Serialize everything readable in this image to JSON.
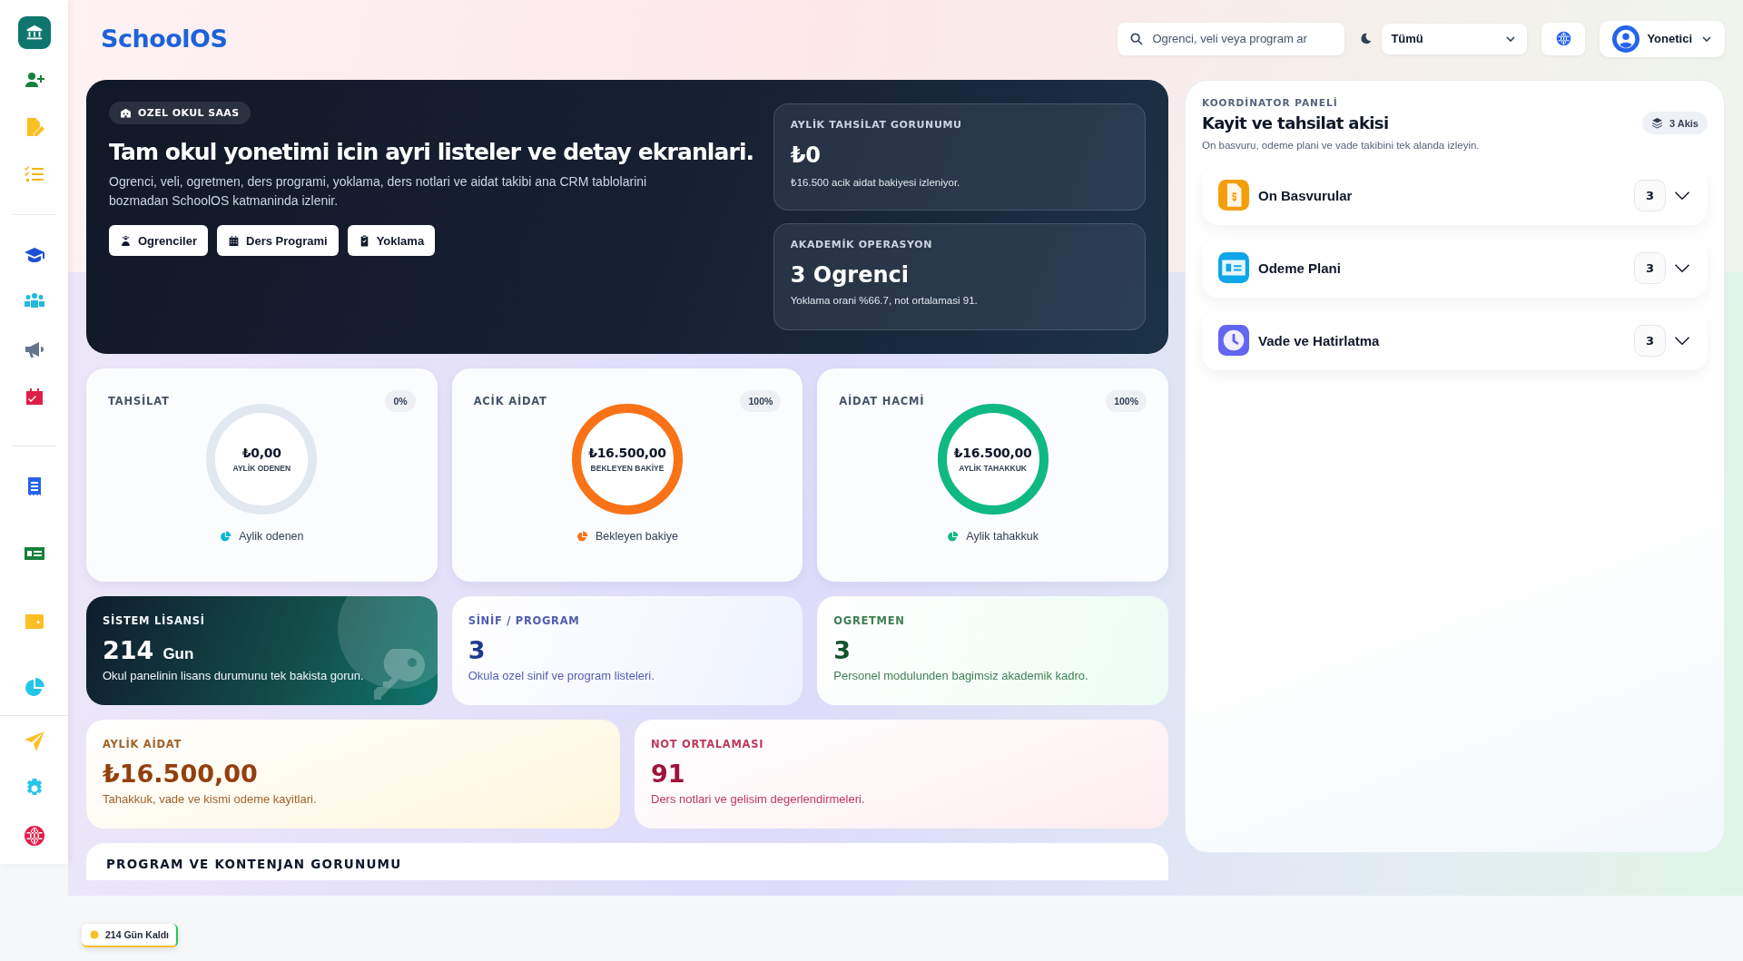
{
  "sidebar": {
    "groups": [
      {
        "items": [
          {
            "kind": "bank",
            "selected": true
          },
          {
            "kind": "user-plus",
            "selected": false
          },
          {
            "kind": "file-pen",
            "selected": false
          },
          {
            "kind": "list-check",
            "selected": false
          }
        ]
      },
      {
        "items": [
          {
            "kind": "graduation",
            "selected": false
          },
          {
            "kind": "people",
            "selected": false
          },
          {
            "kind": "megaphone",
            "selected": false
          },
          {
            "kind": "calendar",
            "selected": false
          }
        ]
      },
      {
        "items": [
          {
            "kind": "receipt",
            "selected": false
          },
          {
            "kind": "money",
            "selected": false
          },
          {
            "kind": "wallet",
            "selected": false
          },
          {
            "kind": "pie",
            "selected": false
          }
        ]
      },
      {
        "items": [
          {
            "kind": "plane",
            "selected": false
          },
          {
            "kind": "gear",
            "selected": false
          },
          {
            "kind": "globe",
            "selected": false
          }
        ]
      }
    ]
  },
  "header": {
    "logo": "SchoolOS",
    "search": {
      "placeholder": "Ogrenci, veli veya program ar"
    },
    "filter": "Tümü",
    "user": "Yonetici"
  },
  "hero": {
    "badge": "OZEL OKUL SAAS",
    "title": "Tam okul yonetimi icin ayri listeler ve detay ekranlari.",
    "description": "Ogrenci, veli, ogretmen, ders programi, yoklama, ders notlari ve aidat takibi ana CRM tablolarini bozmadan SchoolOS katmaninda izlenir.",
    "buttons": [
      {
        "label": "Ogrenciler",
        "kind": "student"
      },
      {
        "label": "Ders Programi",
        "kind": "calendar"
      },
      {
        "label": "Yoklama",
        "kind": "clipboard"
      }
    ],
    "metrics": [
      {
        "label": "AYLİK TAHSİLAT GORUNUMU",
        "value": "₺0",
        "note": "₺16.500 acik aidat bakiyesi izleniyor."
      },
      {
        "label": "AKADEMİK OPERASYON",
        "value": "3 Ogrenci",
        "note": "Yoklama orani %66.7, not ortalamasi 91."
      }
    ]
  },
  "rings": [
    {
      "title": "TAHSİLAT",
      "badge": "0%",
      "value": "₺0,00",
      "caption": "AYLİK ODENEN",
      "legend": "Aylik odenen",
      "color": "#06b6d4"
    },
    {
      "title": "ACİK AİDAT",
      "badge": "100%",
      "value": "₺16.500,00",
      "caption": "BEKLEYEN BAKİYE",
      "legend": "Bekleyen bakiye",
      "color": "#f97316"
    },
    {
      "title": "AİDAT HACMİ",
      "badge": "100%",
      "value": "₺16.500,00",
      "caption": "AYLİK TAHAKKUK",
      "legend": "Aylik tahakkuk",
      "color": "#10b981"
    }
  ],
  "info_cards": [
    {
      "kind": "license",
      "title": "SİSTEM LİSANSİ",
      "value": "214",
      "unit": "Gun",
      "note": "Okul panelinin lisans durumunu tek bakista gorun."
    },
    {
      "kind": "blue",
      "title": "SİNİF / PROGRAM",
      "value": "3",
      "note": "Okula ozel sinif ve program listeleri."
    },
    {
      "kind": "green",
      "title": "OGRETMEN",
      "value": "3",
      "note": "Personel modulunden bagimsiz akademik kadro."
    }
  ],
  "highlight_cards": [
    {
      "kind": "amber",
      "title": "AYLİK AİDAT",
      "value": "₺16.500,00",
      "note": "Tahakkuk, vade ve kismi odeme kayitlari."
    },
    {
      "kind": "rose",
      "title": "NOT ORTALAMASI",
      "value": "91",
      "note": "Ders notlari ve gelisim degerlendirmeleri."
    }
  ],
  "program_section": {
    "title": "PROGRAM VE KONTENJAN GORUNUMU"
  },
  "coordinator": {
    "label": "KOORDİNATOR PANELİ",
    "title": "Kayit ve tahsilat akisi",
    "badge": "3 Akis",
    "subtitle": "On basvuru, odeme plani ve vade takibini tek alanda izleyin.",
    "flows": [
      {
        "kind": "file",
        "title": "On Basvurular",
        "count": "3",
        "color": "#f59e0b",
        "expanded": false
      },
      {
        "kind": "card",
        "title": "Odeme Plani",
        "count": "3",
        "color": "#0ea5e9",
        "expanded": false
      },
      {
        "kind": "clock",
        "title": "Vade ve Hatirlatma",
        "count": "3",
        "color": "#6366f1",
        "expanded": false
      }
    ]
  },
  "license_badge": "214 Gün Kaldı"
}
